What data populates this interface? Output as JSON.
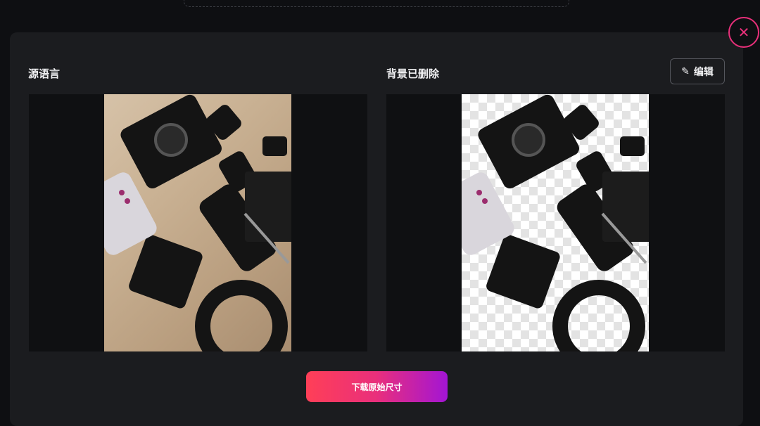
{
  "close": {
    "glyph": "✕"
  },
  "panels": {
    "source": {
      "label": "源语言"
    },
    "result": {
      "label": "背景已删除"
    }
  },
  "edit_button": {
    "icon": "✎",
    "label": "编辑"
  },
  "download_button": {
    "label": "下载原始尺寸"
  },
  "colors": {
    "accent_pink": "#e8307a",
    "gradient_start": "#ff3f57",
    "gradient_end": "#a315d4"
  }
}
